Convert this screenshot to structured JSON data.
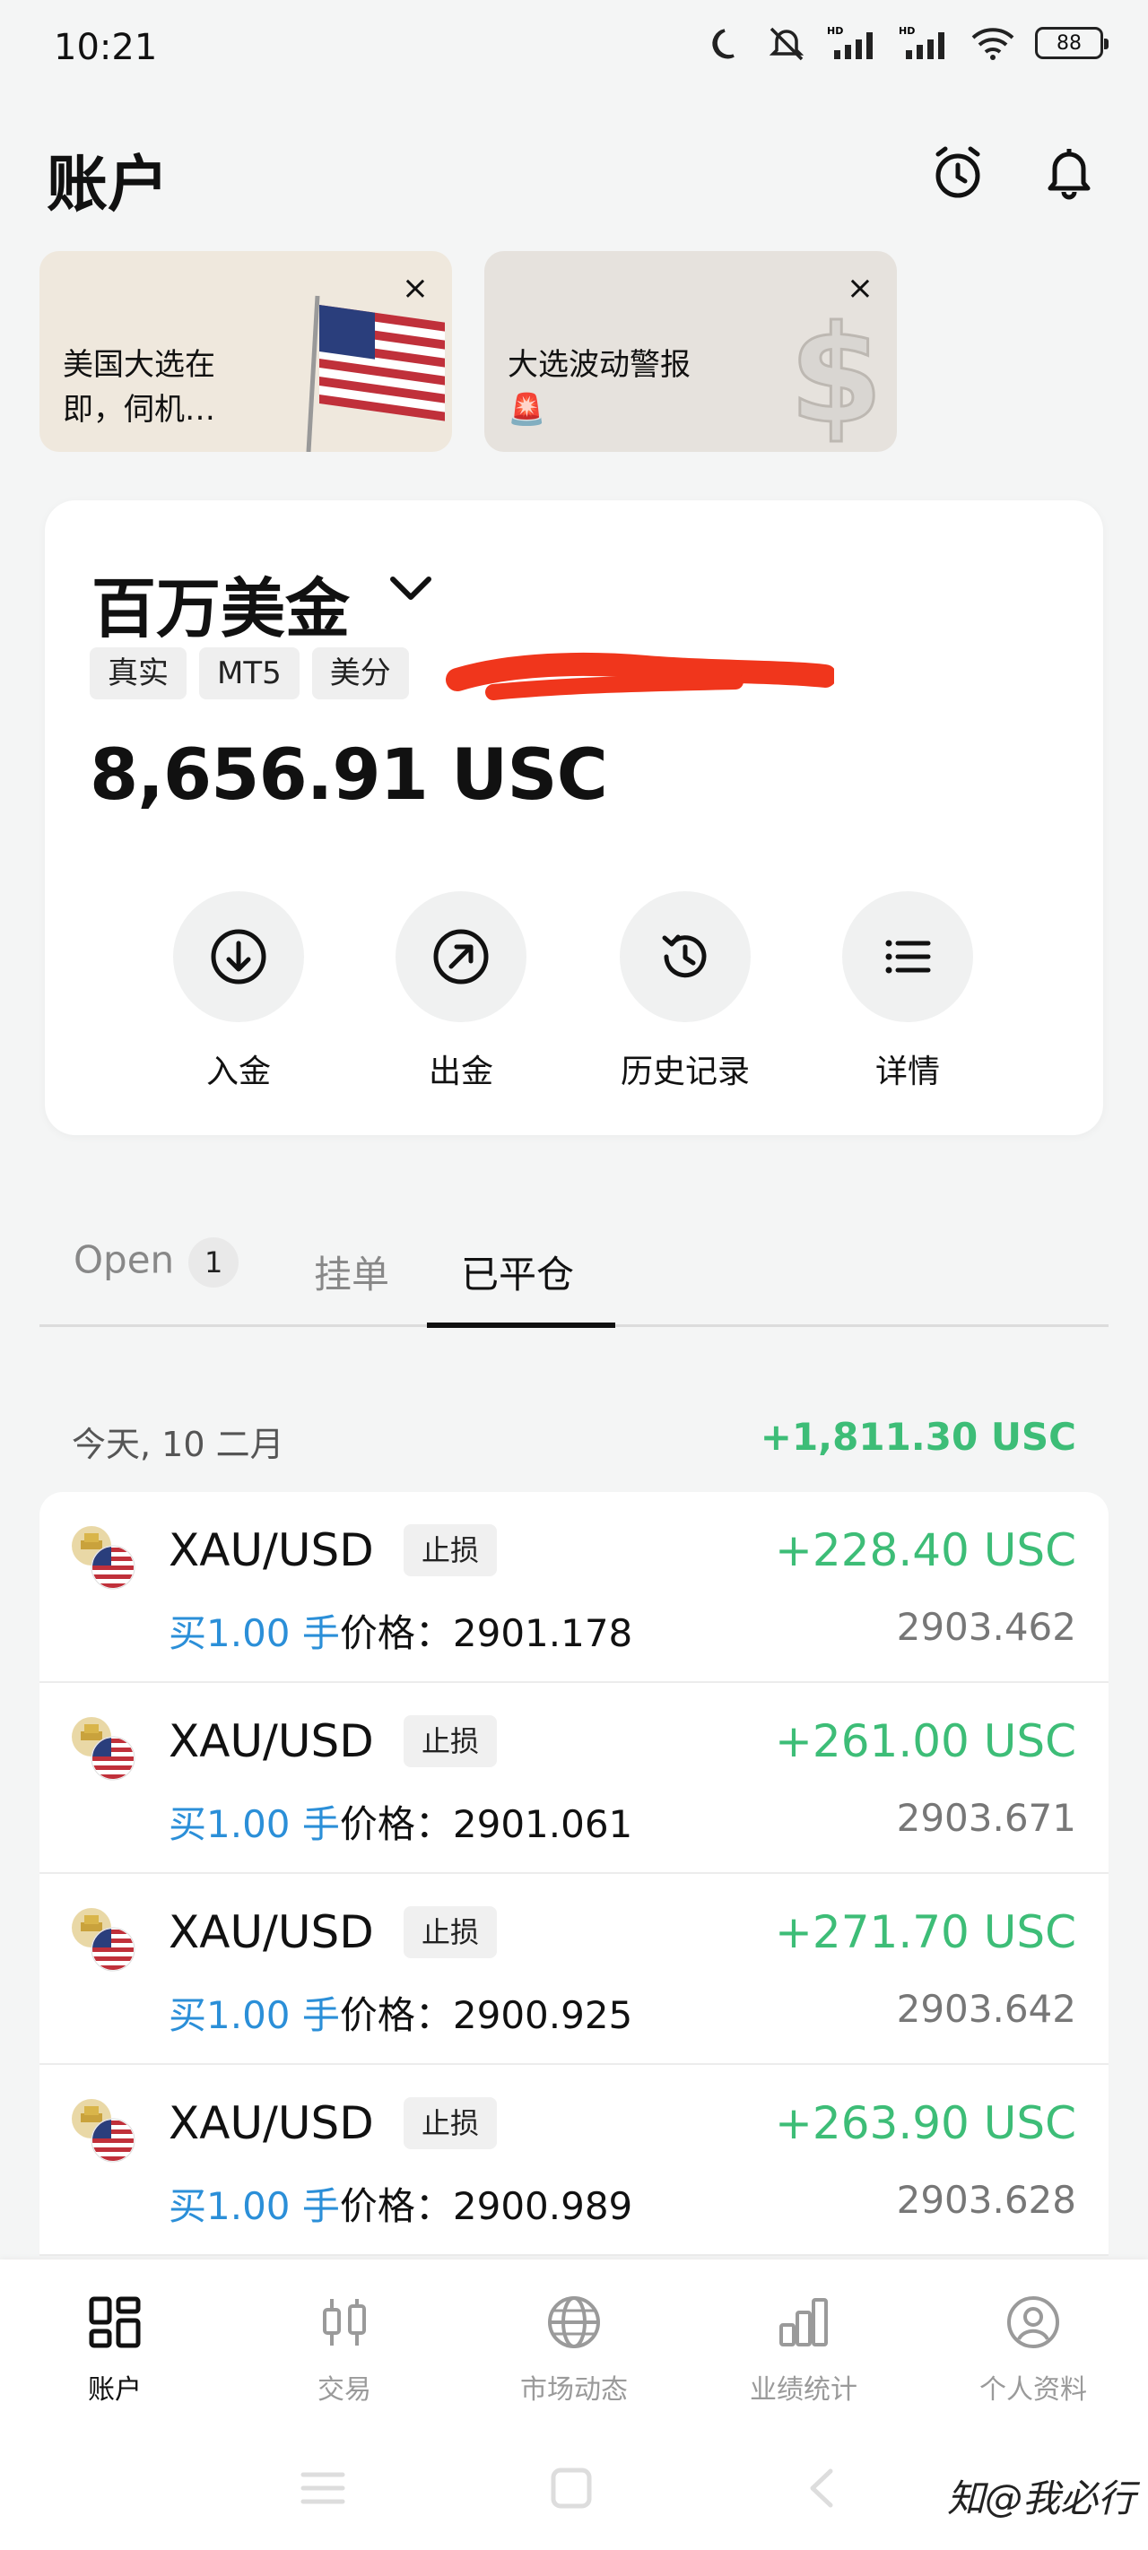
{
  "status_bar": {
    "time": "10:21",
    "battery": "88",
    "icons": [
      "moon-icon",
      "mute-vibrate-icon",
      "signal-icon",
      "signal-icon",
      "wifi-icon",
      "battery-icon"
    ]
  },
  "header": {
    "title": "账户",
    "icons": [
      "alarm-clock-icon",
      "bell-icon"
    ]
  },
  "promos": [
    {
      "text": "美国大选在即，伺机…",
      "close": "×",
      "art": "us-flag"
    },
    {
      "text": "大选波动警报 🚨",
      "close": "×",
      "art": "dollar-sign"
    }
  ],
  "account": {
    "name": "百万美金",
    "tags": [
      "真实",
      "MT5",
      "美分"
    ],
    "balance": "8,656.91 USC",
    "actions": [
      {
        "label": "入金",
        "icon": "deposit-arrow-down-icon"
      },
      {
        "label": "出金",
        "icon": "withdraw-arrow-up-right-icon"
      },
      {
        "label": "历史记录",
        "icon": "history-icon"
      },
      {
        "label": "详情",
        "icon": "list-icon"
      }
    ]
  },
  "tabs": [
    {
      "label": "Open",
      "badge": "1"
    },
    {
      "label": "挂单"
    },
    {
      "label": "已平仓",
      "active": true
    }
  ],
  "group": {
    "date": "今天, 10 二月",
    "total": "+1,811.30 USC"
  },
  "trades": [
    {
      "symbol": "XAU/USD",
      "tag": "止损",
      "pnl": "+228.40 USC",
      "side": "买1.00 手",
      "price_label": "价格：2901.178",
      "close_price": "2903.462"
    },
    {
      "symbol": "XAU/USD",
      "tag": "止损",
      "pnl": "+261.00 USC",
      "side": "买1.00 手",
      "price_label": "价格：2901.061",
      "close_price": "2903.671"
    },
    {
      "symbol": "XAU/USD",
      "tag": "止损",
      "pnl": "+271.70 USC",
      "side": "买1.00 手",
      "price_label": "价格：2900.925",
      "close_price": "2903.642"
    },
    {
      "symbol": "XAU/USD",
      "tag": "止损",
      "pnl": "+263.90 USC",
      "side": "买1.00 手",
      "price_label": "价格：2900.989",
      "close_price": "2903.628"
    }
  ],
  "nav": [
    {
      "label": "账户",
      "icon": "account-grid-icon",
      "active": true
    },
    {
      "label": "交易",
      "icon": "candlestick-icon"
    },
    {
      "label": "市场动态",
      "icon": "globe-icon"
    },
    {
      "label": "业绩统计",
      "icon": "bar-chart-icon"
    },
    {
      "label": "个人资料",
      "icon": "profile-icon"
    }
  ],
  "watermark": "知@我必行",
  "colors": {
    "profit_green": "#3dbd77",
    "buy_blue": "#2b8fd8",
    "background": "#f4f5f5"
  }
}
